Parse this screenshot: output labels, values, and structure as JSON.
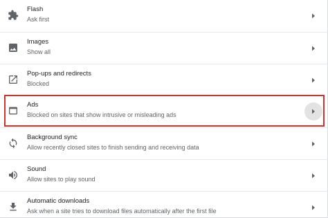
{
  "colors": {
    "icon": "#5f6368",
    "title": "#202124",
    "subtitle": "#5f6368",
    "highlight_border": "#d93025",
    "divider": "#e8eaed"
  },
  "rows": [
    {
      "icon": "puzzle-icon",
      "title": "Flash",
      "subtitle": "Ask first"
    },
    {
      "icon": "image-icon",
      "title": "Images",
      "subtitle": "Show all"
    },
    {
      "icon": "open-in-new-icon",
      "title": "Pop-ups and redirects",
      "subtitle": "Blocked"
    },
    {
      "icon": "web-asset-icon",
      "title": "Ads",
      "subtitle": "Blocked on sites that show intrusive or misleading ads",
      "highlighted": true
    },
    {
      "icon": "sync-icon",
      "title": "Background sync",
      "subtitle": "Allow recently closed sites to finish sending and receiving data"
    },
    {
      "icon": "volume-icon",
      "title": "Sound",
      "subtitle": "Allow sites to play sound"
    },
    {
      "icon": "download-icon",
      "title": "Automatic downloads",
      "subtitle": "Ask when a site tries to download files automatically after the first file"
    }
  ]
}
